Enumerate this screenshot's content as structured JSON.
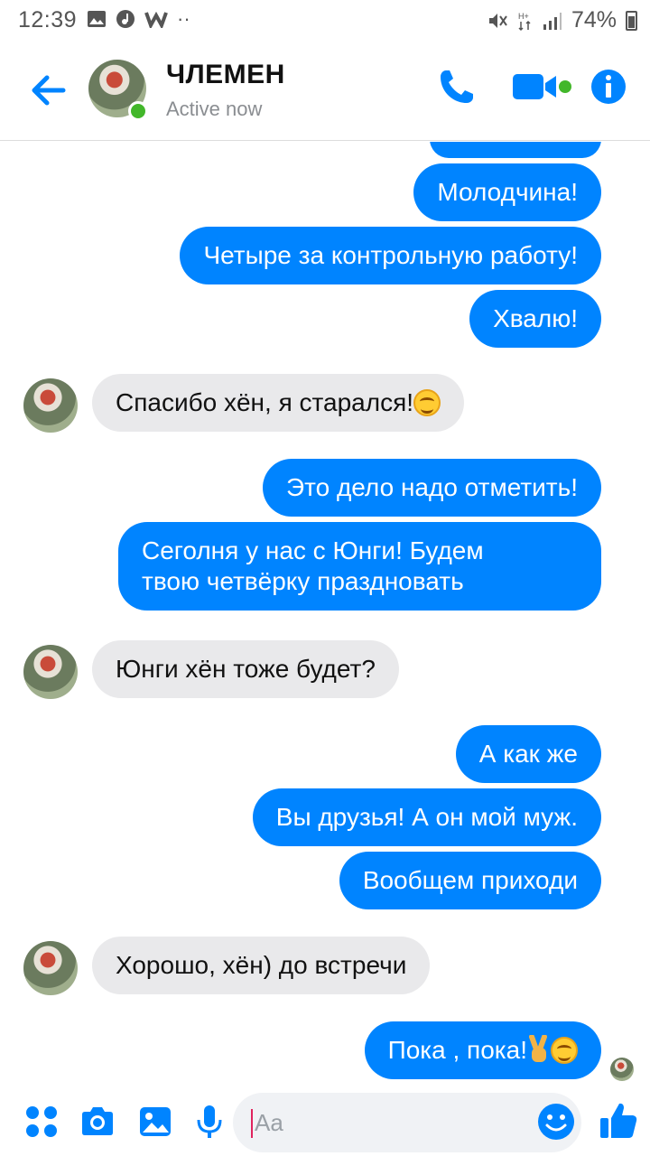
{
  "status_bar": {
    "time": "12:39",
    "battery": "74%"
  },
  "header": {
    "contact_name": "ЧЛЕМЕН",
    "status": "Active now"
  },
  "messages": [
    {
      "id": "m1",
      "direction": "out",
      "text": "Молодчина!"
    },
    {
      "id": "m2",
      "direction": "out",
      "text": "Четыре за контрольную работу!"
    },
    {
      "id": "m3",
      "direction": "out",
      "text": "Хвалю!"
    },
    {
      "id": "m4",
      "direction": "in",
      "text": "Спасибо хён, я старался!",
      "emoji": "smiling-face"
    },
    {
      "id": "m5",
      "direction": "out",
      "text": "Это дело надо отметить!"
    },
    {
      "id": "m6",
      "direction": "out",
      "lines": [
        "Сеголня у нас с Юнги! Будем",
        "твою четвёрку праздновать"
      ]
    },
    {
      "id": "m7",
      "direction": "in",
      "text": "Юнги хён тоже будет?"
    },
    {
      "id": "m8",
      "direction": "out",
      "text": "А как же"
    },
    {
      "id": "m9",
      "direction": "out",
      "text": "Вы друзья! А он мой муж."
    },
    {
      "id": "m10",
      "direction": "out",
      "text": "Вообщем приходи"
    },
    {
      "id": "m11",
      "direction": "in",
      "text": "Хорошо, хён) до встречи"
    },
    {
      "id": "m12",
      "direction": "out",
      "text": "Пока , пока!",
      "emoji": "victory-hand smiling-face"
    }
  ],
  "composer": {
    "placeholder": "Aa"
  },
  "colors": {
    "accent": "#0084ff",
    "incoming_bubble": "#e9e9eb",
    "online": "#42b72a"
  },
  "icons": [
    "back-arrow-icon",
    "phone-icon",
    "video-camera-icon",
    "info-icon",
    "apps-icon",
    "camera-icon",
    "gallery-icon",
    "microphone-icon",
    "emoji-icon",
    "thumbs-up-icon"
  ]
}
